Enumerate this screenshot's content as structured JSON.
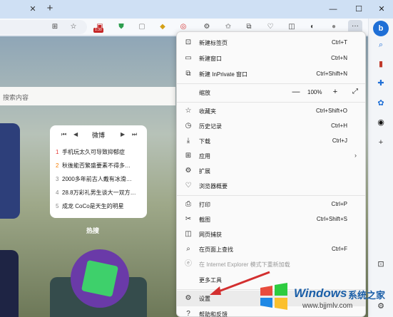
{
  "titlebar": {
    "tab_close_glyph": "✕",
    "new_tab_glyph": "+",
    "minimize_glyph": "—",
    "maximize_glyph": "☐",
    "close_glyph": "✕"
  },
  "toolbar": {
    "badge": "1:30",
    "more_glyph": "···"
  },
  "page": {
    "search_placeholder": "搜索内容",
    "weibo": {
      "prev": "⏮",
      "back": "◀",
      "title": "微博",
      "forward": "▶",
      "next": "⏭",
      "items": [
        {
          "num": "1",
          "text": "手机玩太久可导致抑郁症"
        },
        {
          "num": "2",
          "text": "秋後能否繁盛要素不得多…"
        },
        {
          "num": "3",
          "text": "2000多年前古人戴有冰滑…"
        },
        {
          "num": "4",
          "text": "28.8万彩礼男生谈大一双方…"
        },
        {
          "num": "5",
          "text": "成龙 CoCo是天生的明星"
        }
      ]
    },
    "hot_label": "热搜"
  },
  "menu": {
    "items": [
      {
        "icon": "new-tab-icon",
        "glyph": "⊡",
        "label": "新建标签页",
        "shortcut": "Ctrl+T"
      },
      {
        "icon": "new-window-icon",
        "glyph": "▭",
        "label": "新建窗口",
        "shortcut": "Ctrl+N"
      },
      {
        "icon": "inprivate-icon",
        "glyph": "⧉",
        "label": "新建 InPrivate 窗口",
        "shortcut": "Ctrl+Shift+N"
      },
      {
        "icon": "favorites-icon",
        "glyph": "☆",
        "label": "收藏夹",
        "shortcut": "Ctrl+Shift+O"
      },
      {
        "icon": "history-icon",
        "glyph": "◷",
        "label": "历史记录",
        "shortcut": "Ctrl+H"
      },
      {
        "icon": "download-icon",
        "glyph": "⤓",
        "label": "下载",
        "shortcut": "Ctrl+J"
      },
      {
        "icon": "apps-icon",
        "glyph": "⊞",
        "label": "应用",
        "shortcut": ""
      },
      {
        "icon": "extensions-icon",
        "glyph": "⚙",
        "label": "扩展",
        "shortcut": ""
      },
      {
        "icon": "essentials-icon",
        "glyph": "♡",
        "label": "浏览器概要",
        "shortcut": ""
      },
      {
        "icon": "print-icon",
        "glyph": "⎙",
        "label": "打印",
        "shortcut": "Ctrl+P"
      },
      {
        "icon": "screenshot-icon",
        "glyph": "✂",
        "label": "截图",
        "shortcut": "Ctrl+Shift+S"
      },
      {
        "icon": "web-capture-icon",
        "glyph": "◫",
        "label": "网页捕获",
        "shortcut": ""
      },
      {
        "icon": "find-icon",
        "glyph": "⌕",
        "label": "在页面上查找",
        "shortcut": "Ctrl+F"
      },
      {
        "icon": "ie-mode-icon",
        "glyph": "ⓔ",
        "label": "在 Internet Explorer 模式下重新加载",
        "shortcut": ""
      },
      {
        "icon": "more-tools-icon",
        "glyph": " ",
        "label": "更多工具",
        "shortcut": ""
      },
      {
        "icon": "settings-icon",
        "glyph": "⚙",
        "label": "设置",
        "shortcut": ""
      },
      {
        "icon": "help-icon",
        "glyph": "?",
        "label": "帮助和反馈",
        "shortcut": ""
      }
    ],
    "zoom": {
      "label": "缩放",
      "minus": "—",
      "value": "100%",
      "plus": "+",
      "fullscreen": "⤢"
    }
  },
  "watermark": {
    "title": "Windows",
    "title2": "系统之家",
    "url": "www.bjjmlv.com"
  },
  "colors": {
    "accent": "#1f6fd6",
    "arrow": "#d32f2f",
    "watermark": "#1b5fa8"
  }
}
